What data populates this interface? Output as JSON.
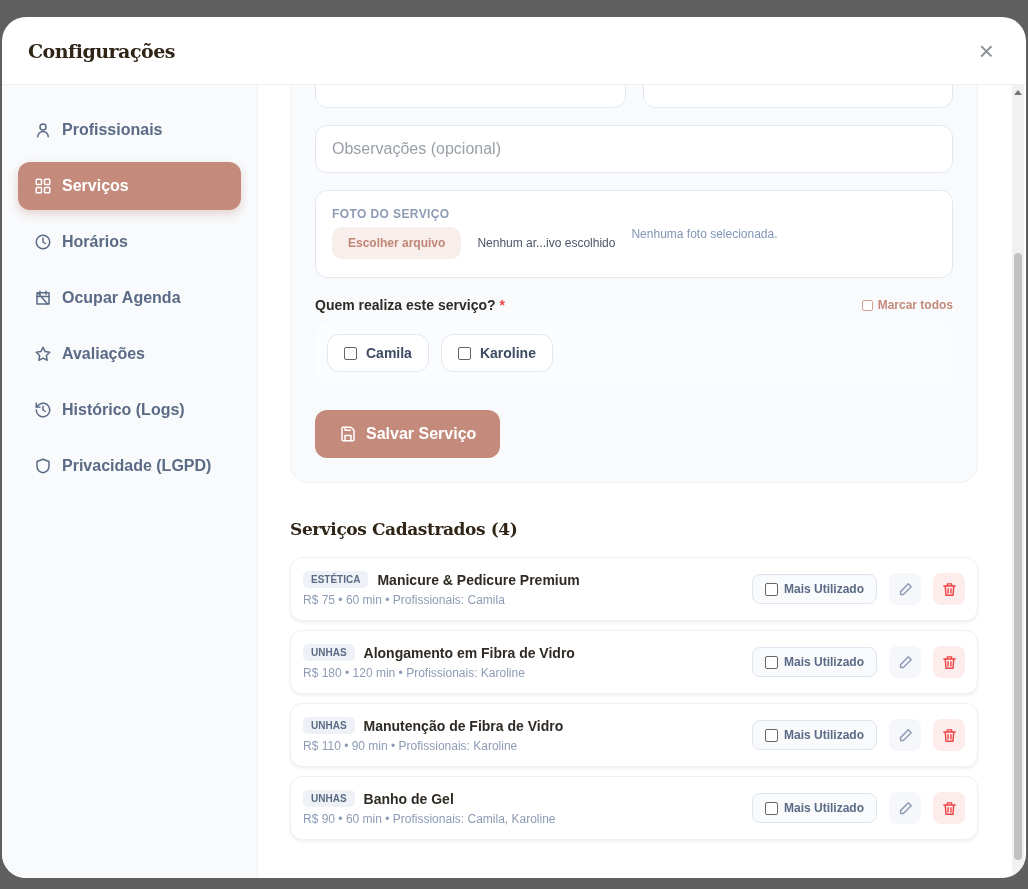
{
  "modal": {
    "title": "Configurações",
    "close": "×"
  },
  "sidebar": {
    "items": [
      {
        "label": "Profissionais",
        "selected": false
      },
      {
        "label": "Serviços",
        "selected": true
      },
      {
        "label": "Horários",
        "selected": false
      },
      {
        "label": "Ocupar Agenda",
        "selected": false
      },
      {
        "label": "Avaliações",
        "selected": false
      },
      {
        "label": "Histórico (Logs)",
        "selected": false
      },
      {
        "label": "Privacidade (LGPD)",
        "selected": false
      }
    ]
  },
  "form": {
    "notes": {
      "placeholder": "Observações (opcional)"
    },
    "photo": {
      "label": "FOTO DO SERVIÇO",
      "button": "Escolher arquivo",
      "file_status": "Nenhum ar...ivo escolhido",
      "preview_status": "Nenhuma foto selecionada."
    },
    "professionals": {
      "label": "Quem realiza este serviço?",
      "required": "*",
      "select_all": {
        "label": "Marcar todos",
        "checked": false
      },
      "options": [
        {
          "label": "Camila",
          "checked": false
        },
        {
          "label": "Karoline",
          "checked": false
        }
      ]
    },
    "save": "Salvar Serviço"
  },
  "services": {
    "title": "Serviços Cadastrados (4)",
    "items": [
      {
        "tag": "ESTÉTICA",
        "name": "Manicure & Pedicure Premium",
        "details": "R$ 75 • 60 min • Profissionais: Camila",
        "featured": {
          "label": "Mais Utilizado",
          "checked": false
        }
      },
      {
        "tag": "UNHAS",
        "name": "Alongamento em Fibra de Vidro",
        "details": "R$ 180 • 120 min • Profissionais: Karoline",
        "featured": {
          "label": "Mais Utilizado",
          "checked": false
        }
      },
      {
        "tag": "UNHAS",
        "name": "Manutenção de Fibra de Vidro",
        "details": "R$ 110 • 90 min • Profissionais: Karoline",
        "featured": {
          "label": "Mais Utilizado",
          "checked": false
        }
      },
      {
        "tag": "UNHAS",
        "name": "Banho de Gel",
        "details": "R$ 90 • 60 min • Profissionais: Camila, Karoline",
        "featured": {
          "label": "Mais Utilizado",
          "checked": false
        }
      }
    ]
  }
}
